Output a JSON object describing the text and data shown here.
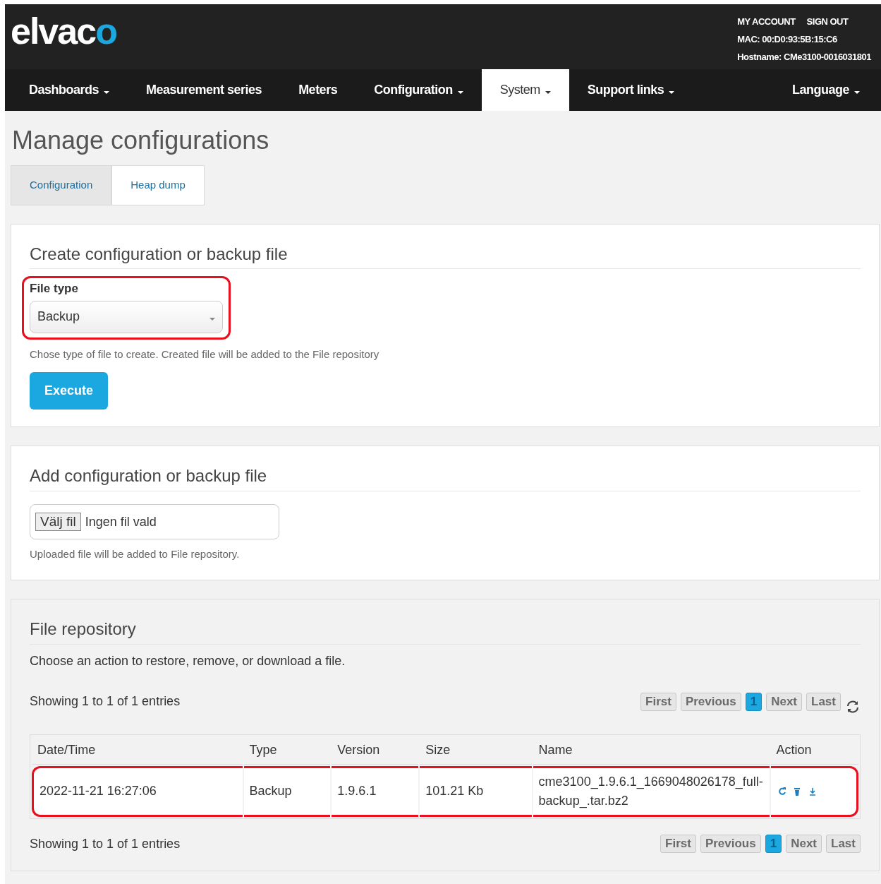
{
  "header": {
    "logo": {
      "text": "elvac",
      "accent": "o"
    },
    "account_links": [
      "MY ACCOUNT",
      "SIGN OUT"
    ],
    "mac": "MAC: 00:D0:93:5B:15:C6",
    "hostname": "Hostname: CMe3100-0016031801"
  },
  "nav": [
    {
      "label": "Dashboards",
      "dropdown": true,
      "selected": false
    },
    {
      "label": "Measurement series",
      "dropdown": false,
      "selected": false
    },
    {
      "label": "Meters",
      "dropdown": false,
      "selected": false
    },
    {
      "label": "Configuration",
      "dropdown": true,
      "selected": false
    },
    {
      "label": "System",
      "dropdown": true,
      "selected": true
    },
    {
      "label": "Support links",
      "dropdown": true,
      "selected": false
    },
    {
      "label": "Language",
      "dropdown": true,
      "selected": false
    }
  ],
  "page_title": "Manage configurations",
  "tabs": [
    {
      "label": "Configuration",
      "selected": true
    },
    {
      "label": "Heap dump",
      "selected": false
    }
  ],
  "create_panel": {
    "title": "Create configuration or backup file",
    "field_label": "File type",
    "select_value": "Backup",
    "highlighted": true,
    "help": "Chose type of file to create. Created file will be added to the File repository",
    "button": "Execute"
  },
  "add_panel": {
    "title": "Add configuration or backup file",
    "file_button": "Välj fil",
    "file_status": "Ingen fil vald",
    "help": "Uploaded file will be added to File repository."
  },
  "repository": {
    "title": "File repository",
    "description": "Choose an action to restore, remove, or download a file.",
    "showing_top": "Showing 1 to 1 of 1 entries",
    "pager_top": [
      {
        "label": "First",
        "selected": false
      },
      {
        "label": "Previous",
        "selected": false
      },
      {
        "label": "1",
        "selected": true
      },
      {
        "label": "Next",
        "selected": false
      },
      {
        "label": "Last",
        "selected": false
      }
    ],
    "columns": [
      "Date/Time",
      "Type",
      "Version",
      "Size",
      "Name",
      "Action"
    ],
    "rows": [
      {
        "cells": [
          "2022-11-21 16:27:06",
          "Backup",
          "1.9.6.1",
          "101.21 Kb",
          "cme3100_1.9.6.1_1669048026178_full-backup_.tar.bz2"
        ],
        "highlighted": true
      }
    ],
    "showing_bottom": "Showing 1 to 1 of 1 entries",
    "pager_bottom": [
      {
        "label": "First",
        "selected": false
      },
      {
        "label": "Previous",
        "selected": false
      },
      {
        "label": "1",
        "selected": true
      },
      {
        "label": "Next",
        "selected": false
      },
      {
        "label": "Last",
        "selected": false
      }
    ]
  }
}
